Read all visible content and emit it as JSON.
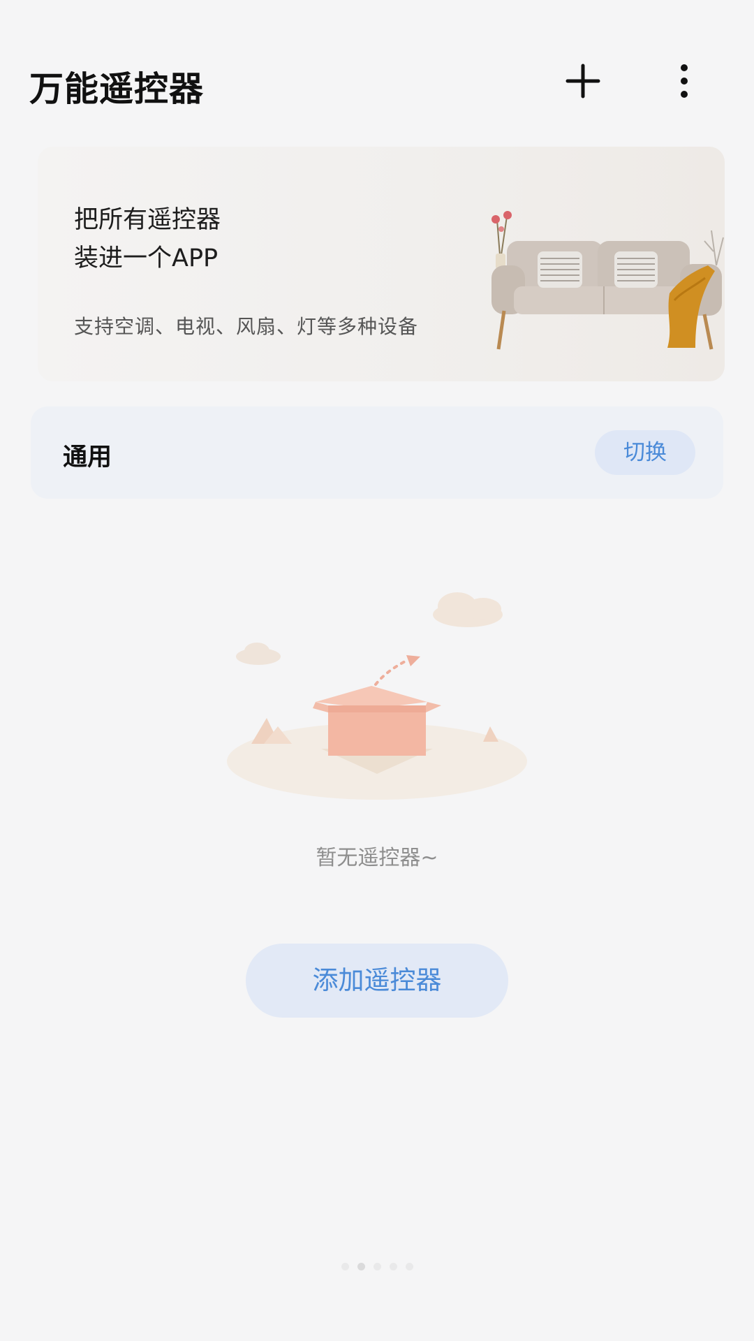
{
  "header": {
    "title": "万能遥控器",
    "add_icon": "plus-icon",
    "more_icon": "more-vertical-icon"
  },
  "banner": {
    "headline_line1": "把所有遥控器",
    "headline_line2": "装进一个APP",
    "subtitle": "支持空调、电视、风扇、灯等多种设备",
    "illustration": "sofa-illustration"
  },
  "mode_card": {
    "label": "通用",
    "switch_label": "切换"
  },
  "empty_state": {
    "illustration": "empty-box-illustration",
    "message": "暂无遥控器~",
    "add_button_label": "添加遥控器"
  },
  "page_indicator": {
    "count": 5,
    "active_index": 1
  },
  "colors": {
    "background": "#f5f5f6",
    "accent": "#4a8ad8",
    "accent_bg": "#e2e9f6",
    "card_bg": "#eef1f6"
  }
}
